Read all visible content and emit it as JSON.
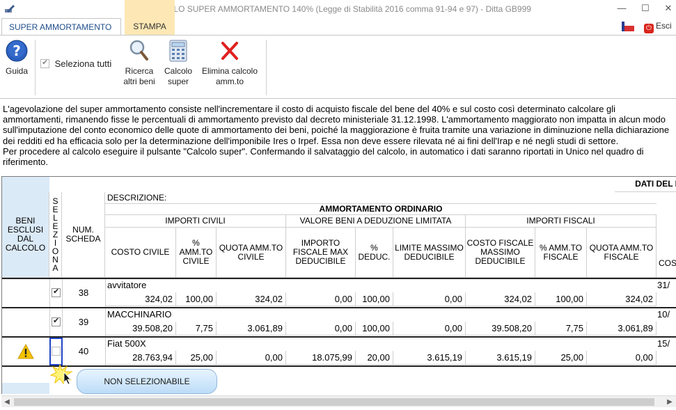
{
  "window": {
    "title": "CALCOLO SUPER AMMORTAMENTO 140% (Legge di Stabilità 2016 comma 91-94 e 97) - Ditta GB999",
    "minimize": "—",
    "maximize": "☐",
    "close": "✕"
  },
  "ribbon_tabs": [
    "SUPER AMMORTAMENTO",
    "STAMPA"
  ],
  "exit_label": "Esci",
  "toolbar": {
    "guida": "Guida",
    "seleziona_tutti": "Seleziona tutti",
    "ricerca_1": "Ricerca",
    "ricerca_2": "altri beni",
    "calcolo_1": "Calcolo",
    "calcolo_2": "super",
    "elimina_1": "Elimina calcolo",
    "elimina_2": "amm.to"
  },
  "info_text": "L'agevolazione del super ammortamento consiste nell'incrementare il costo di acquisto fiscale del bene del 40% e sul costo così determinato calcolare gli ammortamenti, rimanendo fisse le percentuali di ammortamento previsto dal decreto ministeriale 31.12.1998. L'ammortamento maggiorato non impatta in alcun modo sull'imputazione del conto economico delle quote di ammortamento dei beni, poiché la maggiorazione è fruita tramite una variazione in diminuzione nella dichiarazione dei redditi ed ha efficacia solo per la determinazione dell'imponibile Ires o Irpef. Essa non deve essere rilevata né ai fini dell'Irap e né negli studi di settore.",
  "info_text_2": "Per procedere al calcolo eseguire il pulsante \"Calcolo super\". Confermando il salvataggio del calcolo, in automatico i dati saranno riportati in Unico nel quadro di riferimento.",
  "grid": {
    "top_header": "DATI DEL I",
    "beni_esclusi": "BENI ESCLUSI DAL CALCOLO",
    "seleziona_letters": [
      "S",
      "E",
      "L",
      "E",
      "Z",
      "I",
      "O",
      "N",
      "A"
    ],
    "num_scheda": "NUM. SCHEDA",
    "descrizione": "DESCRIZIONE:",
    "amm_ordinario": "AMMORTAMENTO ORDINARIO",
    "importi_civili": "IMPORTI CIVILI",
    "valore_beni": "VALORE BENI A DEDUZIONE LIMITATA",
    "importi_fiscali": "IMPORTI FISCALI",
    "columns": [
      "COSTO CIVILE",
      "% AMM.TO CIVILE",
      "QUOTA AMM.TO CIVILE",
      "IMPORTO FISCALE MAX DEDUCIBILE",
      "% DEDUC.",
      "LIMITE MASSIMO DEDUCIBILE",
      "COSTO FISCALE MASSIMO DEDUCIBILE",
      "% AMM.TO FISCALE",
      "QUOTA AMM.TO FISCALE",
      "COS"
    ],
    "rows": [
      {
        "num": "38",
        "desc": "avvitatore",
        "checked": true,
        "excluded": false,
        "cut": "31/",
        "values": [
          "324,02",
          "100,00",
          "324,02",
          "0,00",
          "100,00",
          "0,00",
          "324,02",
          "100,00",
          "324,02"
        ]
      },
      {
        "num": "39",
        "desc": "MACCHINARIO",
        "checked": true,
        "excluded": false,
        "cut": "10/",
        "values": [
          "39.508,20",
          "7,75",
          "3.061,89",
          "0,00",
          "100,00",
          "0,00",
          "39.508,20",
          "7,75",
          "3.061,89"
        ]
      },
      {
        "num": "40",
        "desc": "Fiat 500X",
        "checked": false,
        "excluded": true,
        "cut": "15/",
        "values": [
          "28.763,94",
          "25,00",
          "0,00",
          "18.075,99",
          "20,00",
          "3.615,19",
          "3.615,19",
          "25,00",
          "0,00"
        ]
      }
    ]
  },
  "tooltip": "NON SELEZIONABILE",
  "colors": {
    "accent": "#1f4e8c",
    "excluded_col": "#dbeaf7",
    "warning": "#f2c200",
    "tooltip": "#bcdcf7"
  }
}
